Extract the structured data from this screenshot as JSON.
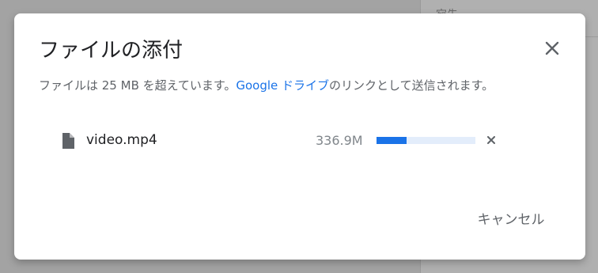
{
  "background": {
    "panel_label": "宛先"
  },
  "dialog": {
    "title": "ファイルの添付",
    "close_icon": "close-icon",
    "message_prefix": "ファイルは 25 MB を超えています。",
    "message_link": "Google ドライブ",
    "message_suffix": "のリンクとして送信されます。",
    "file": {
      "icon": "file-icon",
      "name": "video.mp4",
      "size": "336.9M",
      "progress_fraction": 0.3,
      "remove_icon": "remove-icon"
    },
    "cancel_label": "キャンセル"
  },
  "colors": {
    "accent": "#1a73e8",
    "progress_track": "#e3edfb",
    "text_primary": "#202124",
    "text_secondary": "#5f6368"
  }
}
